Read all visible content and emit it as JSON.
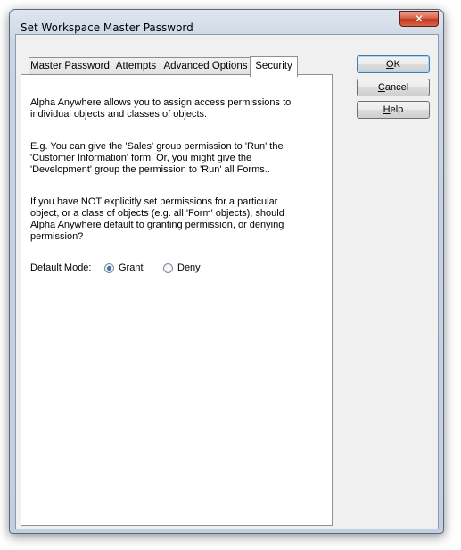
{
  "window": {
    "title": "Set Workspace Master Password",
    "close_glyph": "✕"
  },
  "tabs": [
    {
      "label": "Master Password"
    },
    {
      "label": "Attempts"
    },
    {
      "label": "Advanced Options"
    },
    {
      "label": "Security",
      "active": true
    }
  ],
  "security": {
    "para1": "Alpha Anywhere allows you to assign access permissions to\nindividual objects and classes of objects.",
    "para2": "E.g. You can give the 'Sales' group permission to 'Run' the\n'Customer Information' form. Or, you might give the\n'Development' group the permission to 'Run' all Forms..",
    "para3": "If you have NOT explicitly set permissions for a particular\nobject, or a class of objects (e.g. all 'Form' objects), should\nAlpha Anywhere default to granting permission, or denying\npermission?",
    "default_mode_label": "Default Mode:",
    "options": [
      {
        "label": "Grant",
        "selected": true
      },
      {
        "label": "Deny",
        "selected": false
      }
    ]
  },
  "buttons": {
    "ok": {
      "mnemonic": "O",
      "rest": "K"
    },
    "cancel": {
      "mnemonic": "C",
      "rest": "ancel"
    },
    "help": {
      "mnemonic": "H",
      "rest": "elp"
    }
  }
}
